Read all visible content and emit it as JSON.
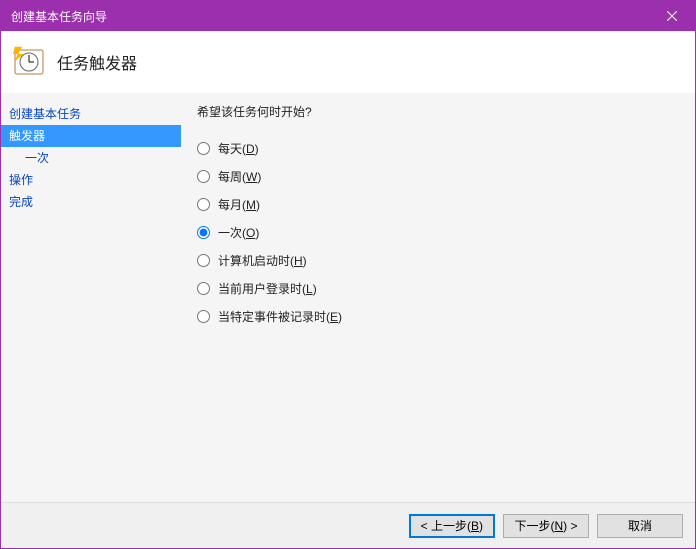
{
  "window": {
    "title": "创建基本任务向导"
  },
  "header": {
    "title": "任务触发器"
  },
  "sidebar": {
    "steps": [
      {
        "label": "创建基本任务",
        "selected": false,
        "sub": false
      },
      {
        "label": "触发器",
        "selected": true,
        "sub": false
      },
      {
        "label": "一次",
        "selected": false,
        "sub": true
      },
      {
        "label": "操作",
        "selected": false,
        "sub": false
      },
      {
        "label": "完成",
        "selected": false,
        "sub": false
      }
    ]
  },
  "content": {
    "prompt": "希望该任务何时开始?",
    "options": [
      {
        "id": "daily",
        "label_pre": "每天(",
        "accel": "D",
        "label_post": ")",
        "checked": false
      },
      {
        "id": "weekly",
        "label_pre": "每周(",
        "accel": "W",
        "label_post": ")",
        "checked": false
      },
      {
        "id": "monthly",
        "label_pre": "每月(",
        "accel": "M",
        "label_post": ")",
        "checked": false
      },
      {
        "id": "once",
        "label_pre": "一次(",
        "accel": "O",
        "label_post": ")",
        "checked": true
      },
      {
        "id": "startup",
        "label_pre": "计算机启动时(",
        "accel": "H",
        "label_post": ")",
        "checked": false
      },
      {
        "id": "logon",
        "label_pre": "当前用户登录时(",
        "accel": "L",
        "label_post": ")",
        "checked": false
      },
      {
        "id": "event",
        "label_pre": "当特定事件被记录时(",
        "accel": "E",
        "label_post": ")",
        "checked": false
      }
    ]
  },
  "footer": {
    "back_pre": "< 上一步(",
    "back_accel": "B",
    "back_post": ")",
    "next_pre": "下一步(",
    "next_accel": "N",
    "next_post": ") >",
    "cancel": "取消"
  }
}
